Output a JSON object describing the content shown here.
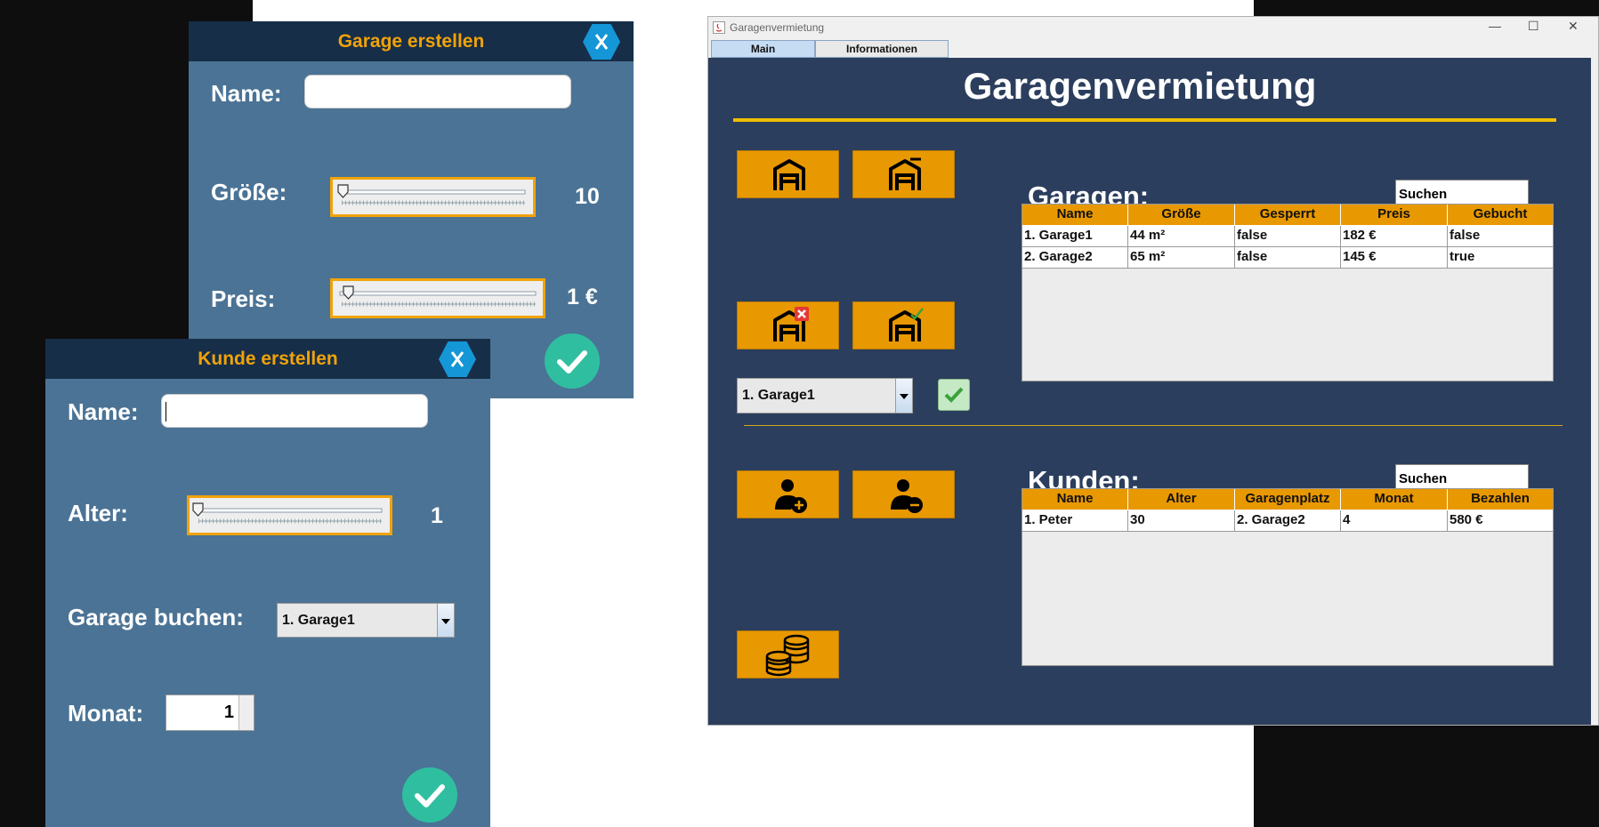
{
  "garage_dialog": {
    "title": "Garage erstellen",
    "name_label": "Name:",
    "name_value": "",
    "size_label": "Größe:",
    "size_value": "10",
    "price_label": "Preis:",
    "price_value": "1 €"
  },
  "customer_dialog": {
    "title": "Kunde erstellen",
    "name_label": "Name:",
    "name_value": "",
    "age_label": "Alter:",
    "age_value": "1",
    "garage_label": "Garage buchen:",
    "garage_selected": "1. Garage1",
    "month_label": "Monat:",
    "month_value": "1"
  },
  "main_window": {
    "window_title": "Garagenvermietung",
    "tabs": [
      "Main",
      "Informationen"
    ],
    "heading": "Garagenvermietung",
    "garage_combo_selected": "1. Garage1",
    "garagen": {
      "title": "Garagen:",
      "search_text": "Suchen",
      "columns": [
        "Name",
        "Größe",
        "Gesperrt",
        "Preis",
        "Gebucht"
      ],
      "rows": [
        [
          "1. Garage1",
          "44 m²",
          "false",
          "182 €",
          "false"
        ],
        [
          "2. Garage2",
          "65 m²",
          "false",
          "145 €",
          "true"
        ]
      ]
    },
    "kunden": {
      "title": "Kunden:",
      "search_text": "Suchen",
      "columns": [
        "Name",
        "Alter",
        "Garagenplatz",
        "Monat",
        "Bezahlen"
      ],
      "rows": [
        [
          "1. Peter",
          "30",
          "2. Garage2",
          "4",
          "580 €"
        ]
      ]
    }
  },
  "colors": {
    "accent_orange": "#e89800",
    "dialog_bg": "#4b7395",
    "dialog_header": "#172e48",
    "panel_bg": "#2c3e5d",
    "close_blue": "#1596d6",
    "ok_green": "#2fbfa0"
  },
  "icons": [
    "close-icon",
    "checkmark-icon",
    "garage-icon",
    "garage-remove-icon",
    "garage-lock-icon",
    "garage-unlock-icon",
    "add-user-icon",
    "remove-user-icon",
    "coins-icon",
    "java-icon"
  ]
}
